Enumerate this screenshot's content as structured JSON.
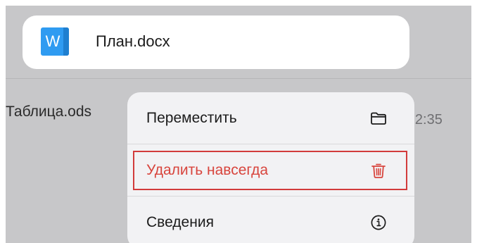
{
  "focused_file": {
    "name": "План.docx",
    "icon_letter": "W",
    "icon": "word-document-icon"
  },
  "background_file": {
    "name": "Таблица.ods",
    "time_fragment": "л, 12:35"
  },
  "context_menu": {
    "items": [
      {
        "label": "Переместить",
        "icon": "folder-icon"
      },
      {
        "label": "Удалить навсегда",
        "icon": "trash-icon",
        "destructive": true
      },
      {
        "label": "Сведения",
        "icon": "info-circle-icon"
      }
    ]
  },
  "colors": {
    "dim_background": "#c7c7c9",
    "menu_background": "#f2f2f4",
    "word_blue": "#2f9bf1",
    "destructive_red": "#d8453d",
    "highlight_border": "#d23b3b"
  }
}
